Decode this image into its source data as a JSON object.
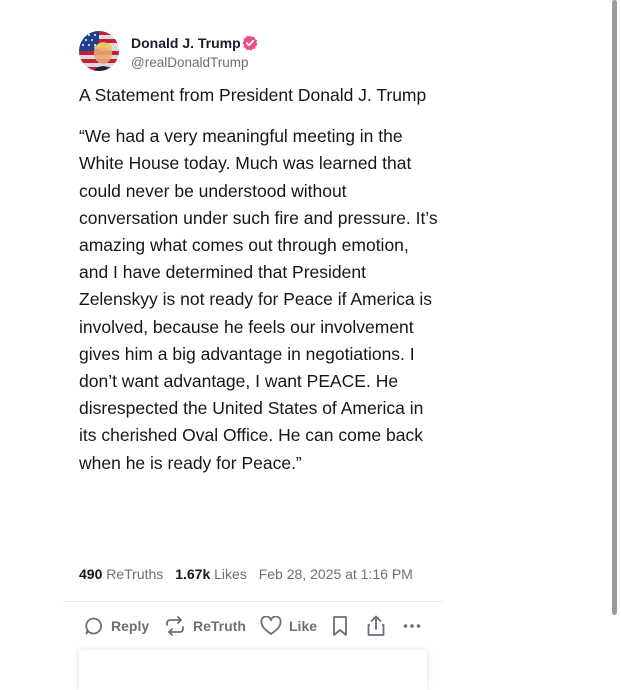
{
  "post": {
    "author": {
      "display_name": "Donald J. Trump",
      "handle": "@realDonaldTrump",
      "verified": true,
      "avatar_icon": "flag-portrait-avatar",
      "verified_icon": "verified-badge-icon"
    },
    "title": "A Statement from President Donald J. Trump",
    "body": "“We had a very meaningful meeting in the White House today. Much was learned that could never be understood without conversation under such fire and pressure. It’s amazing what comes out through emotion, and I have determined that President Zelenskyy is not ready for Peace if America is involved, because he feels our involvement gives him a big advantage in negotiations. I don’t want advantage, I want PEACE. He disrespected the United States of America in its cherished Oval Office. He can come back when he is ready for Peace.”",
    "stats": {
      "retruths_count": "490",
      "retruths_label": "ReTruths",
      "likes_count": "1.67k",
      "likes_label": "Likes",
      "timestamp": "Feb 28, 2025 at 1:16 PM"
    },
    "actions": {
      "reply_label": "Reply",
      "retruth_label": "ReTruth",
      "like_label": "Like"
    }
  },
  "colors": {
    "verified_badge": "#e84f8c",
    "muted_text": "#6e6e7a",
    "primary_text": "#16161e"
  }
}
